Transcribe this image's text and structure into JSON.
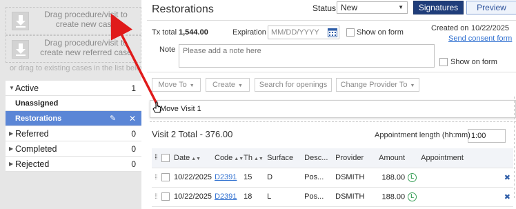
{
  "left_panel": {
    "dropzone_new_case": "Drag procedure/visit to\ncreate new case",
    "dropzone_new_case_line1": "Drag procedure/visit to",
    "dropzone_new_case_line2": "create new case",
    "dropzone_referred_line1": "Drag procedure/visit to",
    "dropzone_referred_line2": "create new referred case",
    "drag_hint": "or drag to existing cases in the list below",
    "groups": [
      {
        "label": "Active",
        "count": "1"
      },
      {
        "label": "Unassigned"
      },
      {
        "label": "Restorations"
      },
      {
        "label": "Referred",
        "count": "0"
      },
      {
        "label": "Completed",
        "count": "0"
      },
      {
        "label": "Rejected",
        "count": "0"
      }
    ]
  },
  "header": {
    "title": "Restorations",
    "status_label": "Status",
    "status_value": "New",
    "signatures_button": "Signatures",
    "preview_button": "Preview"
  },
  "info": {
    "tx_total_label": "Tx total",
    "tx_total_value": "1,544.00",
    "expiration_label": "Expiration",
    "expiration_placeholder": "MM/DD/YYYY",
    "show_on_form_1": "Show on form",
    "created_on_label": "Created on",
    "created_on_value": "10/22/2025",
    "send_consent_link": "Send consent form",
    "note_label": "Note",
    "note_placeholder": "Please add a note here",
    "show_on_form_2": "Show on form"
  },
  "toolbar": {
    "move_to": "Move To",
    "create": "Create",
    "search_openings": "Search for openings",
    "change_provider": "Change Provider To"
  },
  "visit_drop": "Move Visit 1",
  "visit": {
    "total": "Visit 2 Total - 376.00",
    "appt_length_label": "Appointment length (hh:mm)",
    "appt_length_value": "1:00",
    "columns": [
      "Date",
      "Code",
      "Th",
      "Surface",
      "Desc...",
      "Provider",
      "Amount",
      "Appointment"
    ],
    "rows": [
      {
        "date": "10/22/2025",
        "code": "D2391",
        "th": "15",
        "surface": "D",
        "desc": "Pos...",
        "provider": "DSMITH",
        "amount": "188.00"
      },
      {
        "date": "10/22/2025",
        "code": "D2391",
        "th": "18",
        "surface": "L",
        "desc": "Pos...",
        "provider": "DSMITH",
        "amount": "188.00"
      }
    ]
  },
  "colors": {
    "selected_case": "#5b86d6",
    "signatures_bg": "#1f3d7a",
    "link": "#2e6fd0",
    "arrow": "#e01b1b",
    "lab_icon": "#3ba05a"
  }
}
